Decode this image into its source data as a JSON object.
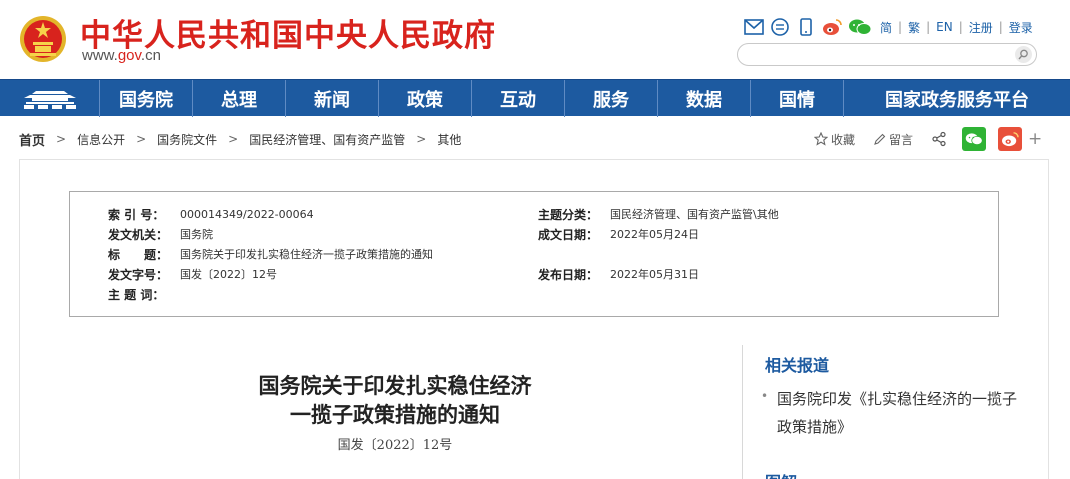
{
  "header": {
    "site_title": "中华人民共和国中央人民政府",
    "url_prefix": "www.",
    "url_red": "gov",
    "url_suffix": ".cn",
    "tool_links": [
      "简",
      "繁",
      "EN",
      "注册",
      "登录"
    ],
    "search_placeholder": ""
  },
  "nav": {
    "items": [
      "国务院",
      "总理",
      "新闻",
      "政策",
      "互动",
      "服务",
      "数据",
      "国情",
      "国家政务服务平台"
    ]
  },
  "breadcrumb": {
    "items": [
      "首页",
      "信息公开",
      "国务院文件",
      "国民经济管理、国有资产监管",
      "其他"
    ],
    "separator": ">"
  },
  "share": {
    "favorite": "收藏",
    "comment": "留言",
    "more": "+"
  },
  "meta": {
    "index_label": "索 引 号：",
    "index_value": "000014349/2022-00064",
    "category_label": "主题分类：",
    "category_value": "国民经济管理、国有资产监管\\其他",
    "issuer_label": "发文机关：",
    "issuer_value": "国务院",
    "written_label": "成文日期：",
    "written_value": "2022年05月24日",
    "title_label": "标　　题：",
    "title_value": "国务院关于印发扎实稳住经济一揽子政策措施的通知",
    "docno_label": "发文字号：",
    "docno_value": "国发〔2022〕12号",
    "published_label": "发布日期：",
    "published_value": "2022年05月31日",
    "keywords_label": "主 题 词：",
    "keywords_value": ""
  },
  "document": {
    "title_line1": "国务院关于印发扎实稳住经济",
    "title_line2": "一揽子政策措施的通知",
    "number": "国发〔2022〕12号"
  },
  "sidebar": {
    "related_title": "相关报道",
    "related_link": "国务院印发《扎实稳住经济的一揽子政策措施》",
    "bullet": "•",
    "section2_title": "图解"
  },
  "colors": {
    "brand_red": "#d8231d",
    "nav_blue": "#1d5aa0",
    "wechat_green": "#2fb335",
    "weibo_red": "#e8503a"
  }
}
